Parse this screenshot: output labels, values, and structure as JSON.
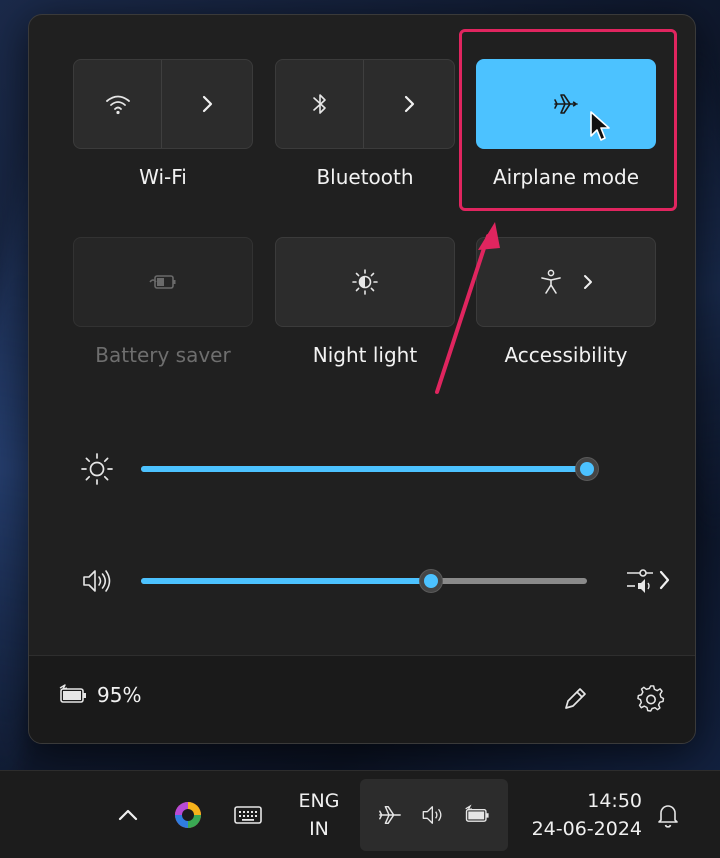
{
  "quick_settings": {
    "tiles_row1": [
      {
        "label": "Wi-Fi",
        "icon": "wifi-icon",
        "has_arrow": true,
        "state": "off"
      },
      {
        "label": "Bluetooth",
        "icon": "bluetooth-icon",
        "has_arrow": true,
        "state": "off"
      },
      {
        "label": "Airplane mode",
        "icon": "airplane-icon",
        "has_arrow": false,
        "state": "on"
      }
    ],
    "tiles_row2": [
      {
        "label": "Battery saver",
        "icon": "battery-saver-icon",
        "has_arrow": false,
        "state": "disabled"
      },
      {
        "label": "Night light",
        "icon": "night-light-icon",
        "has_arrow": false,
        "state": "off"
      },
      {
        "label": "Accessibility",
        "icon": "accessibility-icon",
        "has_arrow": true,
        "state": "off"
      }
    ],
    "brightness": {
      "icon": "brightness-icon",
      "level_percent": 100
    },
    "volume": {
      "icon": "speaker-icon",
      "level_percent": 65,
      "end_icon": "audio-output-icon"
    },
    "footer": {
      "battery_percent": "95%",
      "battery_icon": "battery-charging-icon",
      "edit_icon": "pencil-icon",
      "settings_icon": "gear-icon"
    }
  },
  "taskbar": {
    "lang_line1": "ENG",
    "lang_line2": "IN",
    "time": "14:50",
    "date": "24-06-2024",
    "tray_icons": [
      "airplane-icon",
      "speaker-icon",
      "battery-charging-icon"
    ],
    "icons": [
      "chevron-up-icon",
      "copilot-icon",
      "keyboard-icon",
      "bell-icon"
    ]
  },
  "colors": {
    "accent": "#4cc2ff",
    "panel": "#202020",
    "highlight": "#e0255f"
  }
}
